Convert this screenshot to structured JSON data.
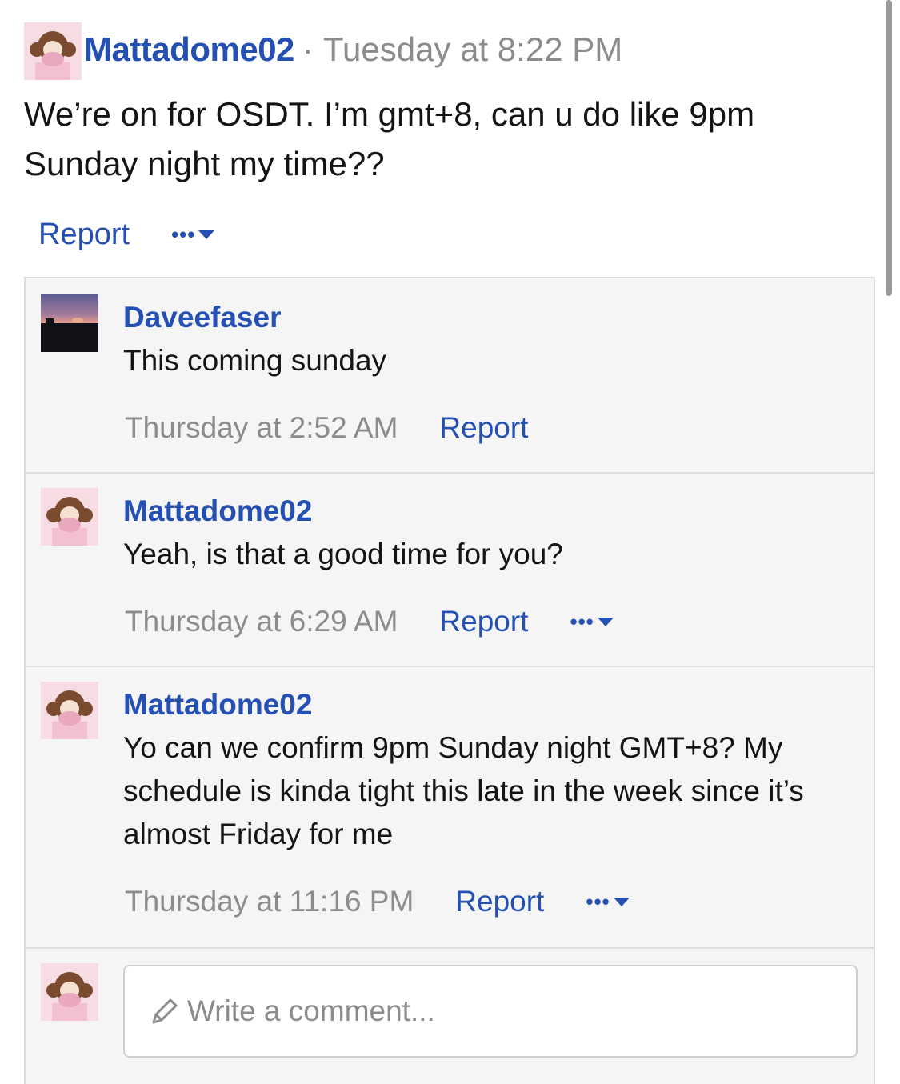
{
  "post": {
    "author": "Mattadome02",
    "separator": "·",
    "timestamp": "Tuesday at 8:22 PM",
    "body": "We’re on for OSDT. I’m gmt+8, can u do like 9pm Sunday night my time??",
    "report_label": "Report",
    "more_label": "•••"
  },
  "comments": [
    {
      "author": "Daveefaser",
      "text": "This coming sunday",
      "timestamp": "Thursday at 2:52 AM",
      "report_label": "Report"
    },
    {
      "author": "Mattadome02",
      "text": "Yeah, is that a good time for you?",
      "timestamp": "Thursday at 6:29 AM",
      "report_label": "Report",
      "more_label": "•••"
    },
    {
      "author": "Mattadome02",
      "text": "Yo can we confirm 9pm Sunday night GMT+8? My schedule is kinda tight this late in the week since it’s almost Friday for me",
      "timestamp": "Thursday at 11:16 PM",
      "report_label": "Report",
      "more_label": "•••"
    }
  ],
  "composer": {
    "placeholder": "Write a comment..."
  },
  "icons": {
    "more": "chevron-down-icon",
    "composer": "pencil-icon"
  },
  "colors": {
    "link": "#2450b4",
    "muted": "#8c8c8c",
    "comment_bg": "#f5f5f5",
    "border": "#dddddd"
  }
}
